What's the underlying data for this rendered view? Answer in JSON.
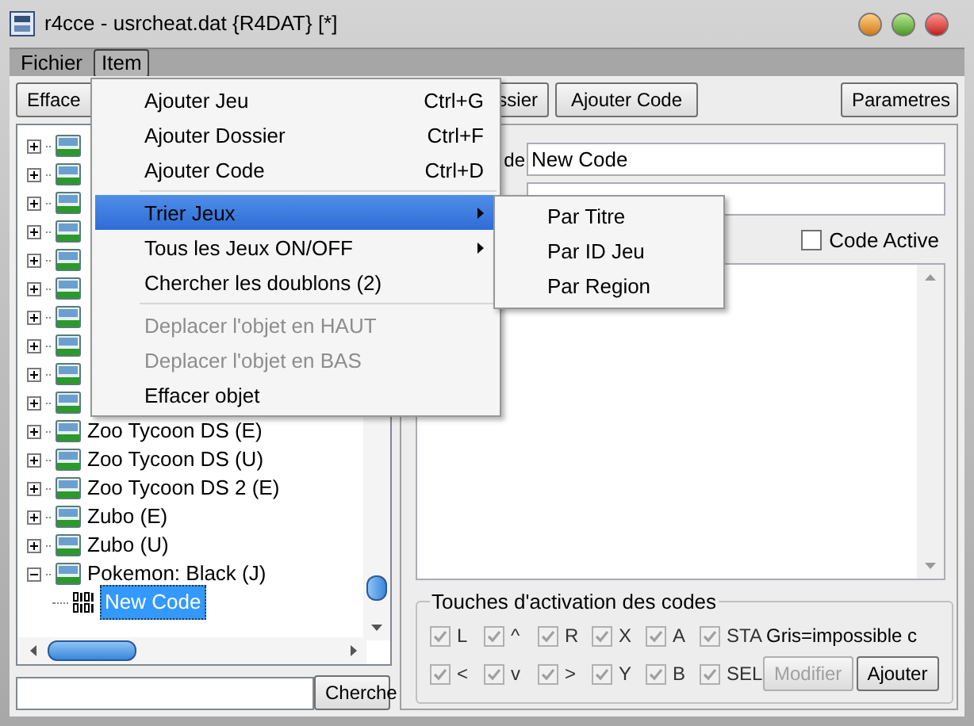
{
  "window": {
    "title": "r4cce - usrcheat.dat {R4DAT} [*]"
  },
  "menu_bar": [
    {
      "label": "Fichier",
      "selected": false
    },
    {
      "label": "Item",
      "selected": true
    }
  ],
  "item_menu": [
    {
      "kind": "item",
      "label": "Ajouter Jeu",
      "shortcut": "Ctrl+G",
      "disabled": false,
      "selected": false,
      "submenu": false
    },
    {
      "kind": "item",
      "label": "Ajouter Dossier",
      "shortcut": "Ctrl+F",
      "disabled": false,
      "selected": false,
      "submenu": false
    },
    {
      "kind": "item",
      "label": "Ajouter Code",
      "shortcut": "Ctrl+D",
      "disabled": false,
      "selected": false,
      "submenu": false
    },
    {
      "kind": "separator"
    },
    {
      "kind": "item",
      "label": "Trier Jeux",
      "disabled": false,
      "selected": true,
      "submenu": true
    },
    {
      "kind": "item",
      "label": "Tous les Jeux ON/OFF",
      "disabled": false,
      "selected": false,
      "submenu": true
    },
    {
      "kind": "item",
      "label": "Chercher les doublons (2)",
      "disabled": false,
      "selected": false,
      "submenu": false
    },
    {
      "kind": "separator"
    },
    {
      "kind": "item",
      "label": "Deplacer l'objet en HAUT",
      "disabled": true,
      "selected": false,
      "submenu": false
    },
    {
      "kind": "item",
      "label": "Deplacer l'objet en BAS",
      "disabled": true,
      "selected": false,
      "submenu": false
    },
    {
      "kind": "item",
      "label": "Effacer objet",
      "disabled": false,
      "selected": false,
      "submenu": false
    }
  ],
  "submenu": [
    "Par Titre",
    "Par ID Jeu",
    "Par Region"
  ],
  "toolbar": {
    "left": [
      "Efface",
      "ssier",
      "Ajouter Code"
    ],
    "right": "Parametres"
  },
  "tree": [
    {
      "expanded": false
    },
    {
      "expanded": false
    },
    {
      "expanded": false
    },
    {
      "expanded": false
    },
    {
      "expanded": false
    },
    {
      "expanded": false
    },
    {
      "expanded": false
    },
    {
      "expanded": false
    },
    {
      "expanded": false
    },
    {
      "expanded": false
    },
    {
      "label": "Zoo Tycoon DS (E)",
      "expanded": false
    },
    {
      "label": "Zoo Tycoon DS (U)",
      "expanded": false
    },
    {
      "label": "Zoo Tycoon DS 2 (E)",
      "expanded": false
    },
    {
      "label": "Zubo (E)",
      "expanded": false
    },
    {
      "label": "Zubo (U)",
      "expanded": false
    },
    {
      "label": "Pokemon: Black (J)",
      "expanded": true,
      "children": [
        {
          "label": "New Code",
          "selected": true
        }
      ]
    }
  ],
  "search": {
    "button": "Cherche"
  },
  "editor": {
    "name_label": "de",
    "name": "New Code",
    "code_active": {
      "label": "Code Active",
      "checked": false
    }
  },
  "keys": {
    "title": "Touches d'activation des codes",
    "rows": [
      [
        {
          "label": "L",
          "checked": true,
          "disabled": true
        },
        {
          "label": "^",
          "checked": true,
          "disabled": true
        },
        {
          "label": "R",
          "checked": true,
          "disabled": true
        },
        {
          "label": "X",
          "checked": true,
          "disabled": true
        },
        {
          "label": "A",
          "checked": true,
          "disabled": true
        },
        {
          "label": "STA",
          "checked": true,
          "disabled": true
        }
      ],
      [
        {
          "label": "<",
          "checked": true,
          "disabled": true
        },
        {
          "label": "v",
          "checked": true,
          "disabled": true
        },
        {
          "label": ">",
          "checked": true,
          "disabled": true
        },
        {
          "label": "Y",
          "checked": true,
          "disabled": true
        },
        {
          "label": "B",
          "checked": true,
          "disabled": true
        },
        {
          "label": "SEL",
          "checked": true,
          "disabled": true
        }
      ]
    ],
    "note": "Gris=impossible c",
    "buttons": [
      {
        "label": "Modifier",
        "disabled": true
      },
      {
        "label": "Ajouter",
        "disabled": false
      }
    ]
  }
}
